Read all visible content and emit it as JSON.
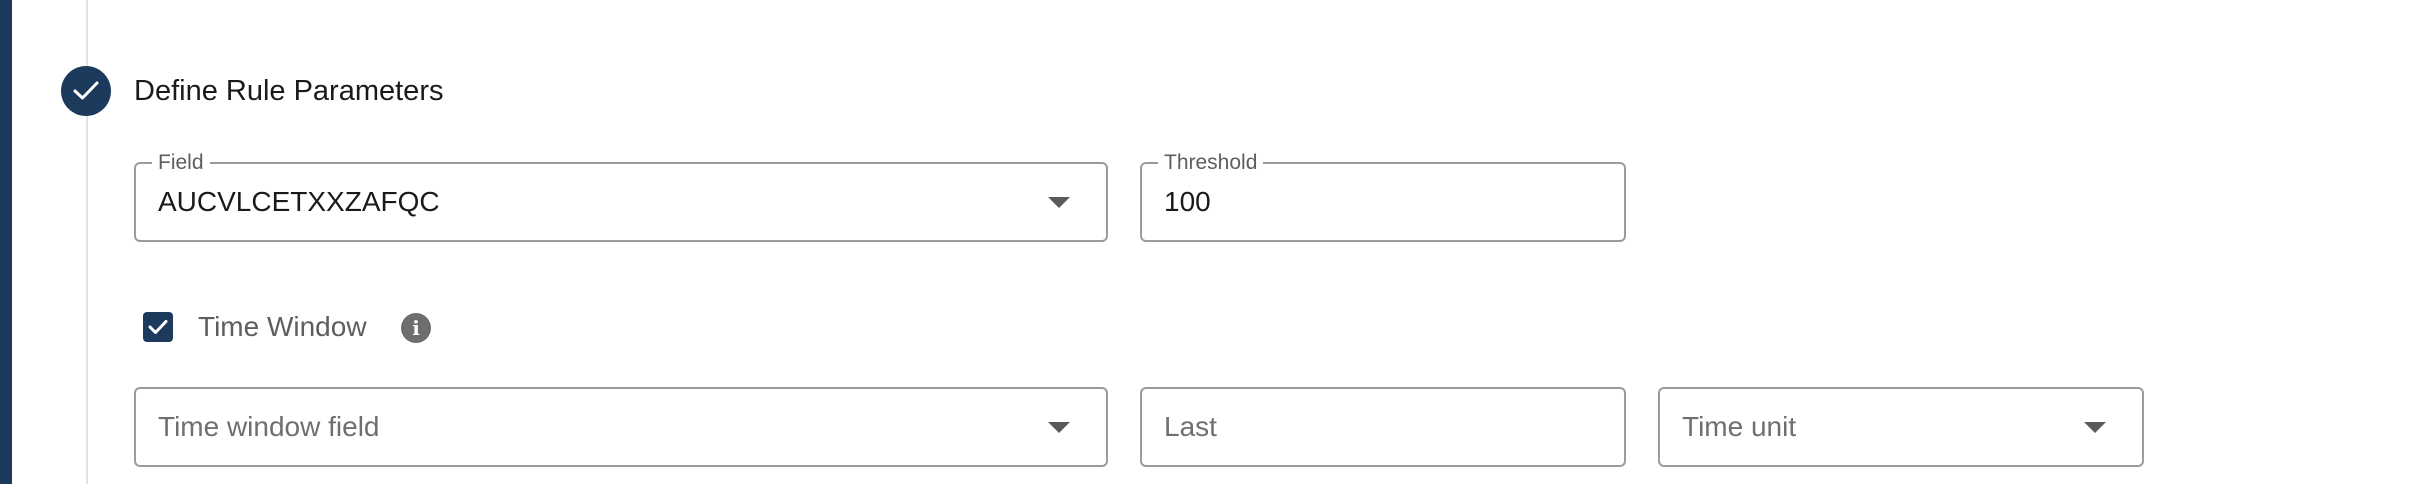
{
  "step": {
    "title": "Define Rule Parameters",
    "status_icon": "check-icon"
  },
  "rule_params": {
    "field": {
      "label": "Field",
      "value": "AUCVLCETXXZAFQC"
    },
    "threshold": {
      "label": "Threshold",
      "value": "100"
    }
  },
  "time_window": {
    "checkbox_label": "Time Window",
    "checked": true,
    "info_icon": "info-icon",
    "time_window_field": {
      "placeholder": "Time window field"
    },
    "last": {
      "placeholder": "Last"
    },
    "time_unit": {
      "placeholder": "Time unit"
    }
  },
  "colors": {
    "accent": "#1c3a5c",
    "border": "#9b9b9b",
    "muted_text": "#5e5e5e"
  }
}
